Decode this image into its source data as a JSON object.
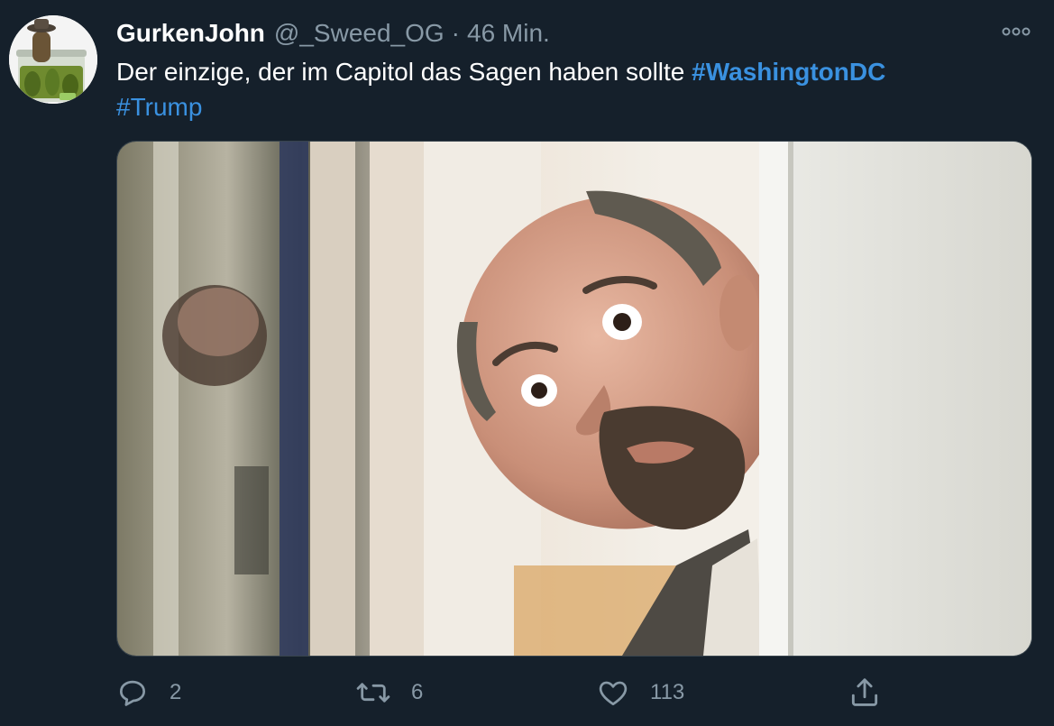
{
  "tweet": {
    "display_name": "GurkenJohn",
    "handle": "@_Sweed_OG",
    "separator": "·",
    "timestamp": "46 Min.",
    "text_plain": "Der einzige, der im Capitol das Sagen haben sollte ",
    "hashtags": [
      "#WashingtonDC",
      "#Trump"
    ],
    "avatar_icon": "pickle-jar-avatar",
    "media_description": "bald-man-peeking-photo"
  },
  "actions": {
    "reply": {
      "icon": "reply-icon",
      "count": "2"
    },
    "retweet": {
      "icon": "retweet-icon",
      "count": "6"
    },
    "like": {
      "icon": "heart-icon",
      "count": "113"
    },
    "share": {
      "icon": "share-icon"
    }
  },
  "colors": {
    "background": "#15202b",
    "text": "#ffffff",
    "secondary": "#8899a6",
    "hashtag": "#3a91e0",
    "border": "#38444d"
  }
}
